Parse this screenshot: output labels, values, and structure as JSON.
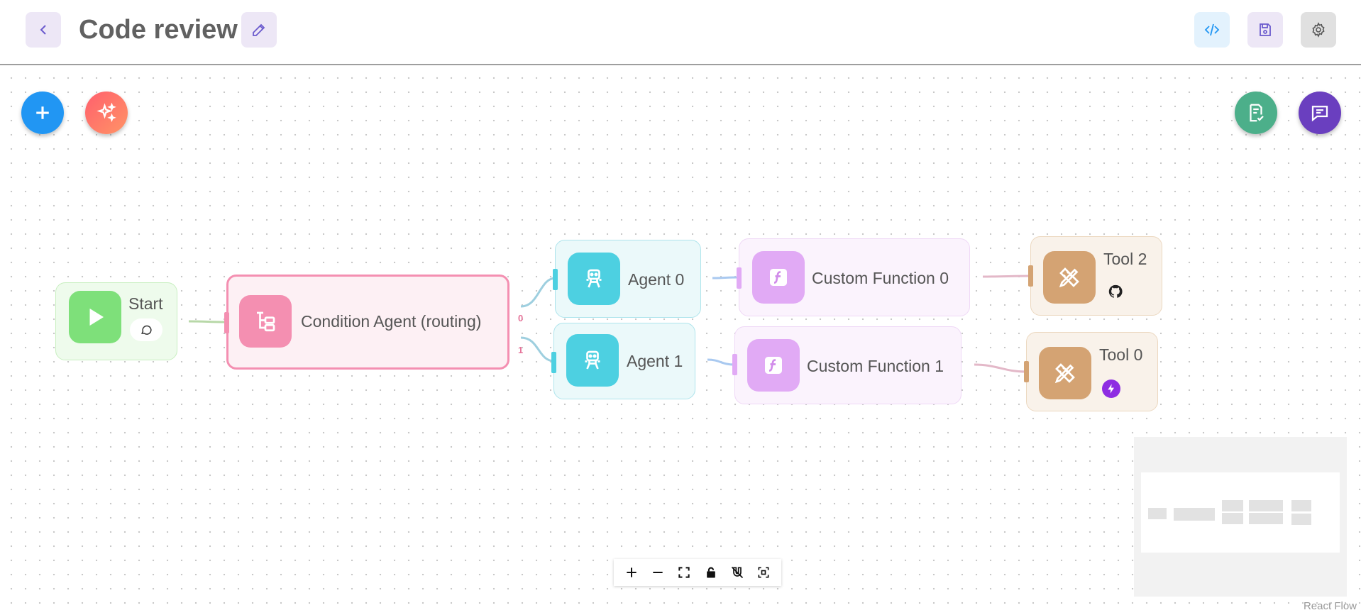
{
  "header": {
    "title": "Code review"
  },
  "nodes": {
    "start": {
      "label": "Start"
    },
    "condition": {
      "label": "Condition Agent (routing)"
    },
    "agent0": {
      "label": "Agent 0"
    },
    "agent1": {
      "label": "Agent 1"
    },
    "func0": {
      "label": "Custom Function 0"
    },
    "func1": {
      "label": "Custom Function 1"
    },
    "tool2": {
      "label": "Tool 2"
    },
    "tool0": {
      "label": "Tool 0"
    }
  },
  "edge_labels": {
    "out0": "0",
    "out1": "1"
  },
  "attribution": "React Flow",
  "colors": {
    "start": "#7ee07a",
    "condition": "#f48fb1",
    "agent": "#4dd0e1",
    "func": "#e1aaf5",
    "tool": "#d4a373",
    "fab_add": "#2196f3",
    "fab_sparkle": "#ff7060",
    "fab_validate": "#4caf8a",
    "fab_chat": "#6a3fbf"
  }
}
